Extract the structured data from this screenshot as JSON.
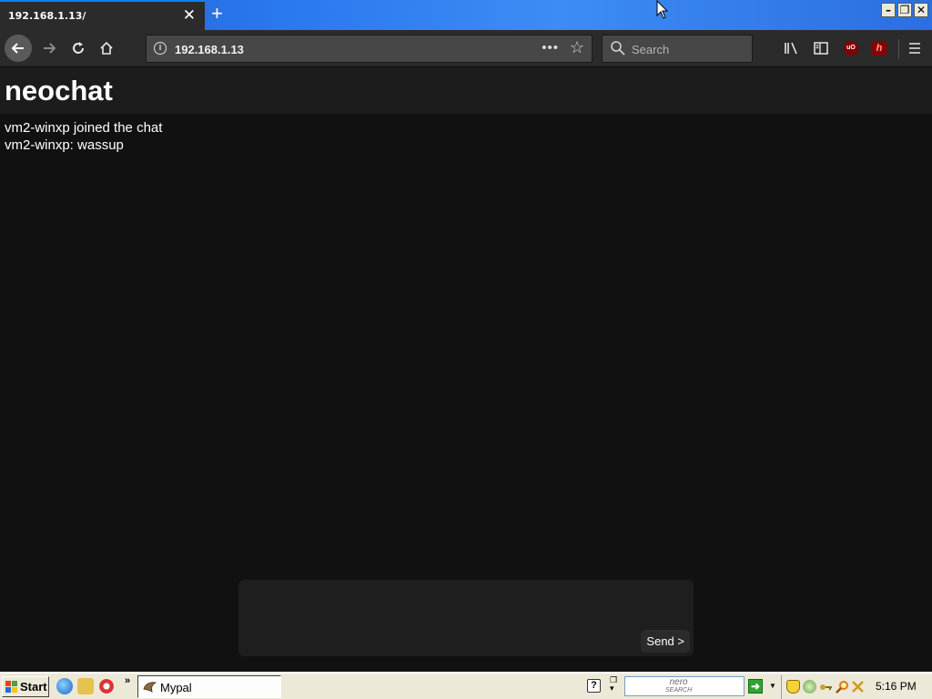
{
  "browser": {
    "tab": {
      "title": "192.168.1.13/",
      "close_label": "✕"
    },
    "new_tab_label": "+",
    "window_buttons": {
      "minimize": "–",
      "restore": "❐",
      "close": "✕"
    },
    "url": "192.168.1.13",
    "url_info_label": "i",
    "search_placeholder": "Search",
    "icons": [
      "back-icon",
      "forward-icon",
      "reload-icon",
      "home-icon",
      "page-actions-icon",
      "bookmark-star-icon",
      "search-icon",
      "library-icon",
      "sidebar-icon",
      "ublock-icon",
      "extension-icon",
      "menu-icon"
    ]
  },
  "page": {
    "title": "neochat",
    "messages": [
      "vm2-winxp joined the chat",
      "vm2-winxp: wassup"
    ],
    "composer": {
      "value": "",
      "send_label": "Send >"
    }
  },
  "taskbar": {
    "start_label": "Start",
    "quick_launch_chevron": "»",
    "task_label": "Mypal",
    "help_label": "?",
    "nero_label": "nero",
    "nero_sub": "SEARCH",
    "clock": "5:16 PM"
  },
  "colors": {
    "page_bg": "#111111",
    "header_bg": "#1c1c1c",
    "toolbar_bg": "#2b2b2b",
    "titlebar_blue": "#2a78ee",
    "taskbar_bg": "#ece9d8"
  }
}
